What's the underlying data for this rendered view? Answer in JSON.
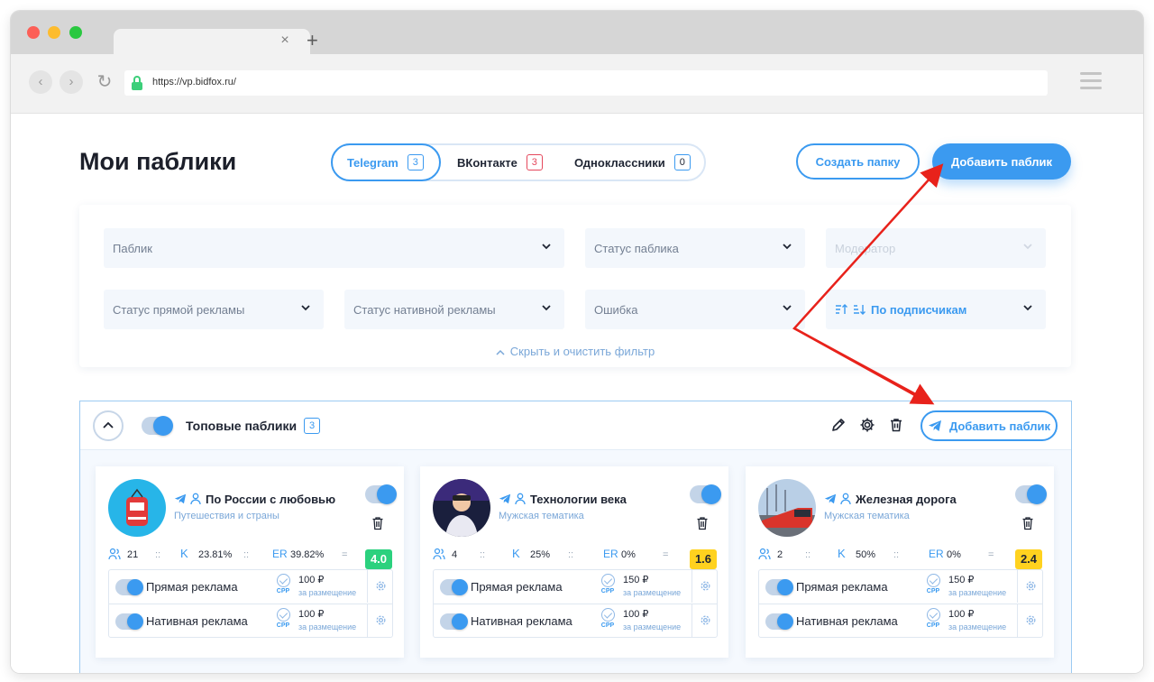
{
  "browser": {
    "url": "https://vp.bidfox.ru/",
    "tab_close": "×",
    "tab_new": "+"
  },
  "header": {
    "title": "Мои паблики",
    "tabs": [
      {
        "label": "Telegram",
        "count": "3"
      },
      {
        "label": "ВКонтакте",
        "count": "3"
      },
      {
        "label": "Одноклассники",
        "count": "0"
      }
    ],
    "create_folder": "Создать папку",
    "add_public": "Добавить паблик"
  },
  "filters": {
    "public": "Паблик",
    "public_status": "Статус паблика",
    "moderator": "Модератор",
    "direct_ad_status": "Статус прямой рекламы",
    "native_ad_status": "Статус нативной рекламы",
    "error": "Ошибка",
    "sort": "По подписчикам",
    "clear": "Скрыть и очистить фильтр"
  },
  "group": {
    "name": "Топовые паблики",
    "count": "3",
    "add_public": "Добавить паблик"
  },
  "labels": {
    "direct": "Прямая реклама",
    "native": "Нативная реклама",
    "cpp": "CPP",
    "per_placement": "за размещение",
    "k": "K",
    "er": "ER",
    "sep": "::",
    "eq": "="
  },
  "cards": [
    {
      "name": "По России с любовью",
      "topic": "Путешествия и страны",
      "subscribers": "21",
      "k": "23.81%",
      "er": "39.82%",
      "score": "4.0",
      "score_color": "#2bd17e",
      "direct_price": "100 ₽",
      "native_price": "100 ₽"
    },
    {
      "name": "Технологии века",
      "topic": "Мужская тематика",
      "subscribers": "4",
      "k": "25%",
      "er": "0%",
      "score": "1.6",
      "score_color": "#ffd21f",
      "direct_price": "150 ₽",
      "native_price": "100 ₽"
    },
    {
      "name": "Железная дорога",
      "topic": "Мужская тематика",
      "subscribers": "2",
      "k": "50%",
      "er": "0%",
      "score": "2.4",
      "score_color": "#ffd21f",
      "direct_price": "150 ₽",
      "native_price": "100 ₽"
    }
  ],
  "colors": {
    "accent": "#3b9af0",
    "arrow": "#e8221b"
  }
}
